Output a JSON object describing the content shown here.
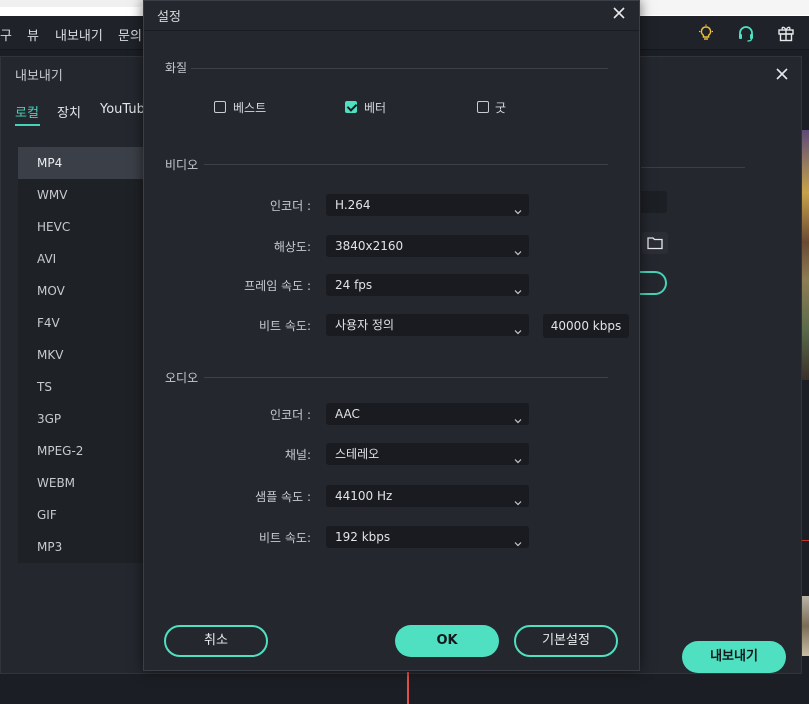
{
  "menubar": {
    "items": [
      "구",
      "뷰",
      "내보내기",
      "문의"
    ]
  },
  "header_icons": [
    "lightbulb-icon",
    "headset-icon",
    "gift-icon"
  ],
  "export_window": {
    "title": "내보내기",
    "tabs": [
      "로컬",
      "장치",
      "YouTube"
    ],
    "active_tab": "로컬",
    "formats": [
      "MP4",
      "WMV",
      "HEVC",
      "AVI",
      "MOV",
      "F4V",
      "MKV",
      "TS",
      "3GP",
      "MPEG-2",
      "WEBM",
      "GIF",
      "MP3"
    ],
    "selected_format": "MP4",
    "export_button": "내보내기"
  },
  "settings_dialog": {
    "title": "설정",
    "quality": {
      "section_label": "화질",
      "options": [
        {
          "label": "베스트",
          "checked": false
        },
        {
          "label": "베터",
          "checked": true
        },
        {
          "label": "굿",
          "checked": false
        }
      ]
    },
    "video": {
      "section_label": "비디오",
      "encoder_label": "인코더 :",
      "encoder_value": "H.264",
      "resolution_label": "해상도:",
      "resolution_value": "3840x2160",
      "framerate_label": "프레임 속도 :",
      "framerate_value": "24 fps",
      "bitrate_label": "비트 속도:",
      "bitrate_value": "사용자 정의",
      "bitrate_custom": "40000 kbps"
    },
    "audio": {
      "section_label": "오디오",
      "encoder_label": "인코더 :",
      "encoder_value": "AAC",
      "channel_label": "채널:",
      "channel_value": "스테레오",
      "samplerate_label": "샘플 속도 :",
      "samplerate_value": "44100 Hz",
      "bitrate_label": "비트 속도:",
      "bitrate_value": "192 kbps"
    },
    "buttons": {
      "cancel": "취소",
      "ok": "OK",
      "default": "기본설정"
    }
  },
  "colors": {
    "accent": "#4ee0c0",
    "background": "#24272e",
    "field": "#191b20"
  }
}
